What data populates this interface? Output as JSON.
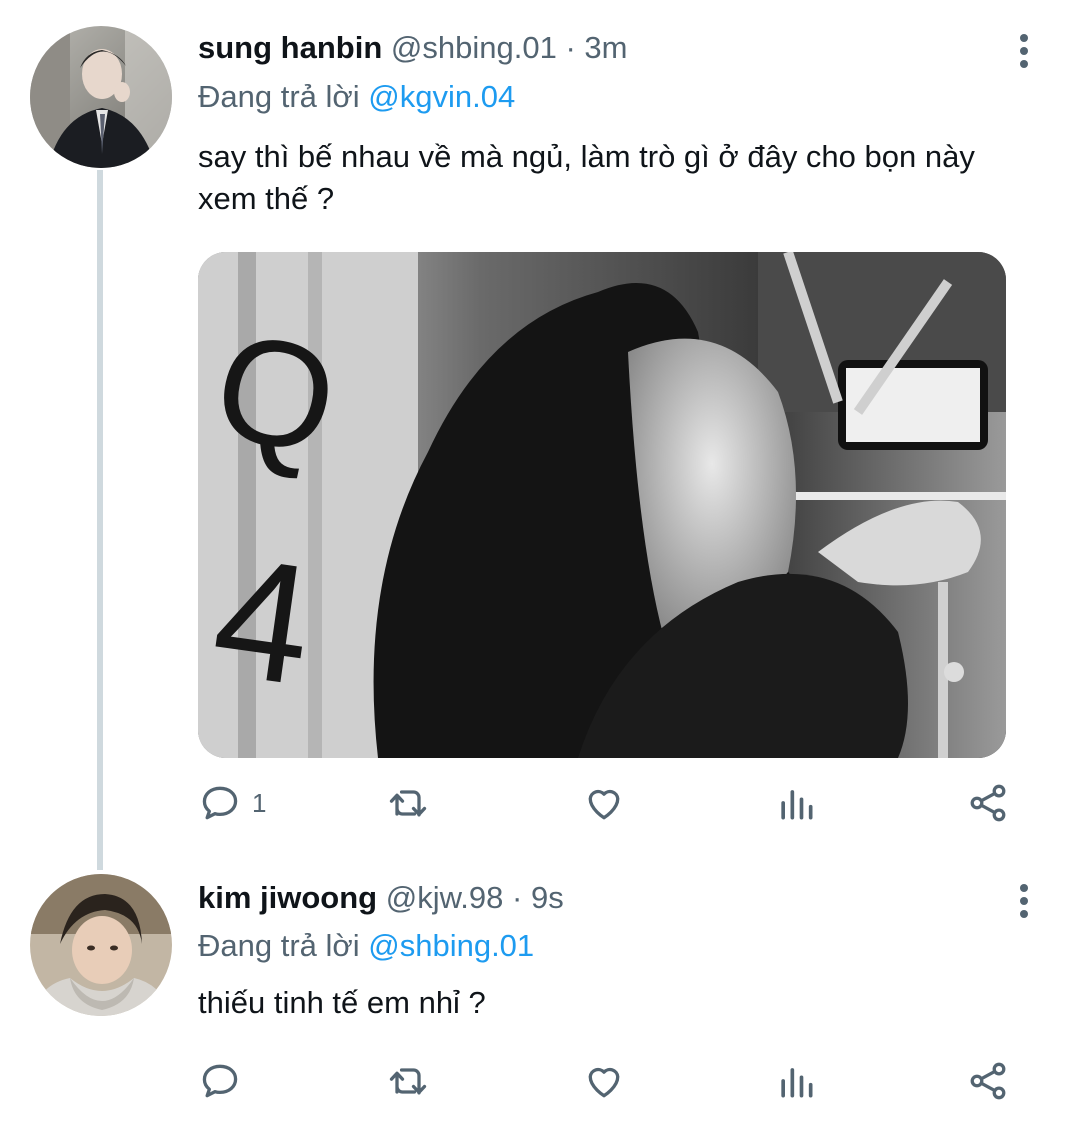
{
  "colors": {
    "accent": "#1d9bf0",
    "muted": "#536471",
    "text": "#0f1419",
    "thread_line": "#cfd9de"
  },
  "tweets": [
    {
      "display_name": "sung hanbin",
      "handle": "@shbing.01",
      "separator": "·",
      "time": "3m",
      "reply_prefix": "Đang trả lời",
      "reply_to": "@kgvin.04",
      "text": "say thì bế nhau về mà ngủ, làm trò gì ở đây cho bọn này xem thế ?",
      "has_media": true,
      "actions": {
        "reply_count": "1",
        "retweet_count": "",
        "like_count": "",
        "views_count": ""
      }
    },
    {
      "display_name": "kim jiwoong",
      "handle": "@kjw.98",
      "separator": "·",
      "time": "9s",
      "reply_prefix": "Đang trả lời",
      "reply_to": "@shbing.01",
      "text": "thiếu tinh tế em nhỉ ?",
      "has_media": false,
      "actions": {
        "reply_count": "",
        "retweet_count": "",
        "like_count": "",
        "views_count": ""
      }
    }
  ],
  "icons": {
    "reply": "reply-bubble-icon",
    "retweet": "retweet-icon",
    "like": "heart-icon",
    "views": "bar-chart-icon",
    "share": "share-icon",
    "more": "more-vertical-icon"
  }
}
